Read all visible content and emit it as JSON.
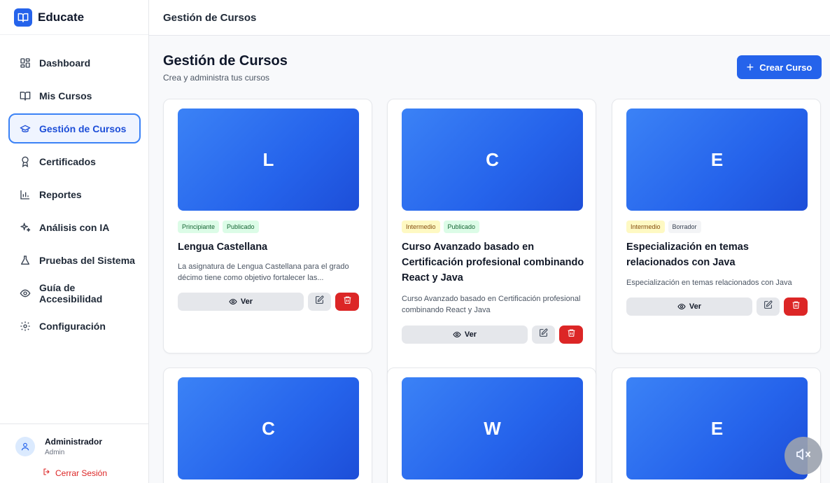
{
  "brand": {
    "name": "Educate"
  },
  "sidebar": {
    "items": [
      {
        "label": "Dashboard",
        "icon": "dashboard-grid-icon"
      },
      {
        "label": "Mis Cursos",
        "icon": "book-open-icon"
      },
      {
        "label": "Gestión de Cursos",
        "icon": "graduation-cap-icon",
        "active": true
      },
      {
        "label": "Certificados",
        "icon": "award-icon"
      },
      {
        "label": "Reportes",
        "icon": "bar-chart-icon"
      },
      {
        "label": "Análisis con IA",
        "icon": "sparkles-icon"
      },
      {
        "label": "Pruebas del Sistema",
        "icon": "flask-icon"
      },
      {
        "label": "Guía de Accesibilidad",
        "icon": "eye-icon"
      },
      {
        "label": "Configuración",
        "icon": "gear-icon"
      }
    ],
    "user": {
      "name": "Administrador",
      "role": "Admin",
      "logout_label": "Cerrar Sesión"
    }
  },
  "topbar": {
    "title": "Gestión de Cursos"
  },
  "main": {
    "title": "Gestión de Cursos",
    "subtitle": "Crea y administra tus cursos",
    "create_label": "Crear Curso"
  },
  "cards": [
    {
      "initial": "L",
      "tags": [
        {
          "label": "Principiante",
          "tone": "green"
        },
        {
          "label": "Publicado",
          "tone": "green"
        }
      ],
      "title": "Lengua Castellana",
      "description": "La asignatura de Lengua Castellana para el grado décimo tiene como objetivo fortalecer las...",
      "view_label": "Ver"
    },
    {
      "initial": "C",
      "tags": [
        {
          "label": "Intermedio",
          "tone": "yellow"
        },
        {
          "label": "Publicado",
          "tone": "green"
        }
      ],
      "title": "Curso Avanzado basado en Certificación profesional combinando React y Java",
      "description": "Curso Avanzado basado en Certificación profesional combinando React y Java",
      "view_label": "Ver"
    },
    {
      "initial": "E",
      "tags": [
        {
          "label": "Intermedio",
          "tone": "yellow"
        },
        {
          "label": "Borrador",
          "tone": "gray"
        }
      ],
      "title": "Especialización en temas relacionados con Java",
      "description": "Especialización en temas relacionados con Java",
      "view_label": "Ver"
    },
    {
      "initial": "C"
    },
    {
      "initial": "W"
    },
    {
      "initial": "E"
    }
  ],
  "colors": {
    "primary": "#2563eb",
    "danger": "#dc2626",
    "tag_green_bg": "#dcfce7",
    "tag_yellow_bg": "#fef9c3",
    "tag_gray_bg": "#f3f4f6"
  }
}
